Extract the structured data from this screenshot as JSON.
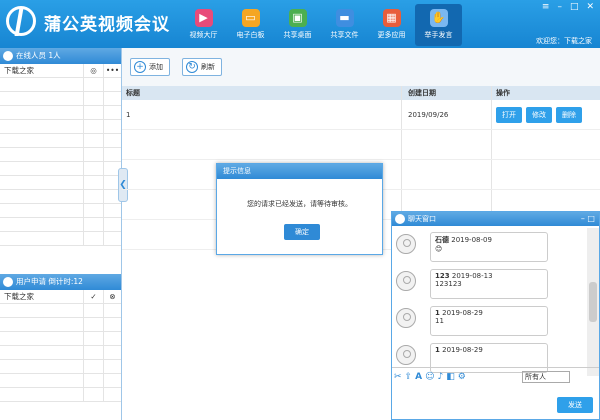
{
  "app": {
    "title": "蒲公英视频会议",
    "welcome": "欢迎您：下载之家"
  },
  "nav": [
    {
      "label": "视频大厅",
      "icon": "video-icon",
      "color": "#e84b7a"
    },
    {
      "label": "电子白板",
      "icon": "whiteboard-icon",
      "color": "#f5a623"
    },
    {
      "label": "共享桌面",
      "icon": "desktop-icon",
      "color": "#4caf50"
    },
    {
      "label": "共享文件",
      "icon": "folder-icon",
      "color": "#3f8ee0"
    },
    {
      "label": "更多应用",
      "icon": "apps-icon",
      "color": "#e85d3b"
    },
    {
      "label": "举手发言",
      "icon": "hand-icon",
      "color": "#7ab7f0"
    }
  ],
  "left": {
    "online_title": "在线人员 1人",
    "online_rows": [
      "下载之家",
      "",
      "",
      "",
      "",
      "",
      "",
      "",
      "",
      "",
      "",
      "",
      ""
    ],
    "apply_title": "用户申请 倒计时:12",
    "apply_rows": [
      "下载之家",
      "",
      "",
      "",
      "",
      "",
      "",
      ""
    ]
  },
  "toolbar": {
    "add": "添加",
    "refresh": "刷新"
  },
  "table": {
    "headers": [
      "标题",
      "创建日期",
      "操作"
    ],
    "rows": [
      {
        "title": "1",
        "date": "2019/09/26",
        "open": "打开",
        "edit": "修改",
        "delete": "删除"
      }
    ]
  },
  "dialog": {
    "title": "提示信息",
    "message": "您的请求已经发送，请等待审核。",
    "ok": "确定"
  },
  "chat": {
    "title": "聊天窗口",
    "messages": [
      {
        "name": "石德",
        "date": "2019-08-09",
        "text": "😊"
      },
      {
        "name": "123",
        "date": "2019-08-13",
        "text": "123123"
      },
      {
        "name": "1",
        "date": "2019-08-29",
        "text": "11"
      },
      {
        "name": "1",
        "date": "2019-08-29",
        "text": ""
      }
    ],
    "receiver": "所有人",
    "send": "发送"
  }
}
